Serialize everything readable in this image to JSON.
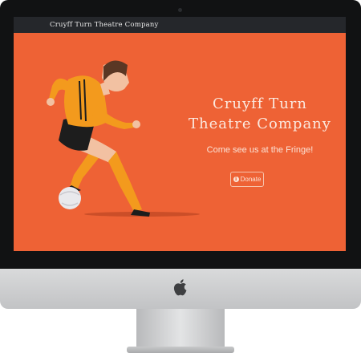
{
  "navbar": {
    "brand": "Cruyff Turn Theatre Company"
  },
  "hero": {
    "title_line1": "Cruyff Turn",
    "title_line2": "Theatre Company",
    "tagline": "Come see us at the Fringe!",
    "donate_label": "Donate",
    "donate_icon": "info-icon"
  },
  "colors": {
    "hero_background": "#ee6235",
    "navbar_background": "#25272b",
    "monitor_bezel": "#111213",
    "kit_orange": "#f39a1d"
  }
}
